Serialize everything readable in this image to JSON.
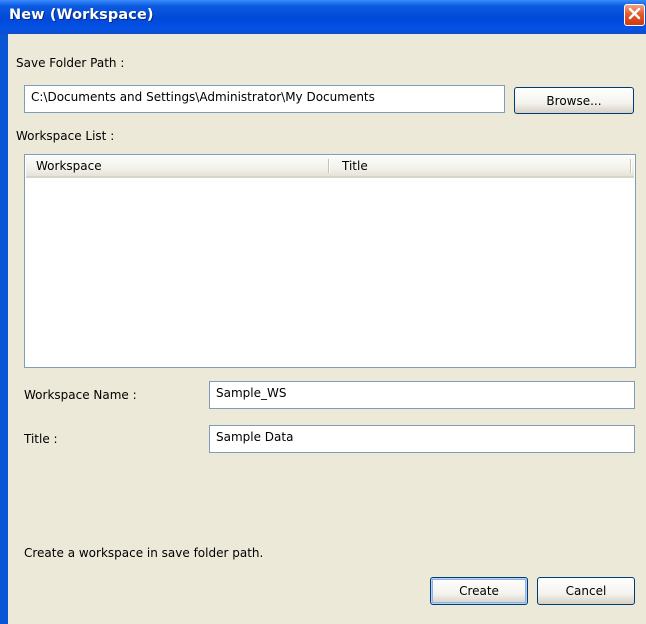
{
  "window": {
    "title": "New (Workspace)"
  },
  "save_folder": {
    "label": "Save Folder Path :",
    "value": "C:\\Documents and Settings\\Administrator\\My Documents",
    "browse_label": "Browse..."
  },
  "workspace_list": {
    "label": "Workspace List :",
    "columns": [
      "Workspace",
      "Title"
    ],
    "rows": []
  },
  "workspace_name": {
    "label": "Workspace Name :",
    "value": "Sample_WS"
  },
  "title_field": {
    "label": "Title :",
    "value": "Sample Data"
  },
  "status": {
    "message": "Create a workspace in save folder path."
  },
  "buttons": {
    "create": "Create",
    "cancel": "Cancel"
  },
  "colors": {
    "titlebar": "#0048d8",
    "close_button": "#e45a2c",
    "dialog_bg": "#ece9d8",
    "input_border": "#7f9db9"
  }
}
